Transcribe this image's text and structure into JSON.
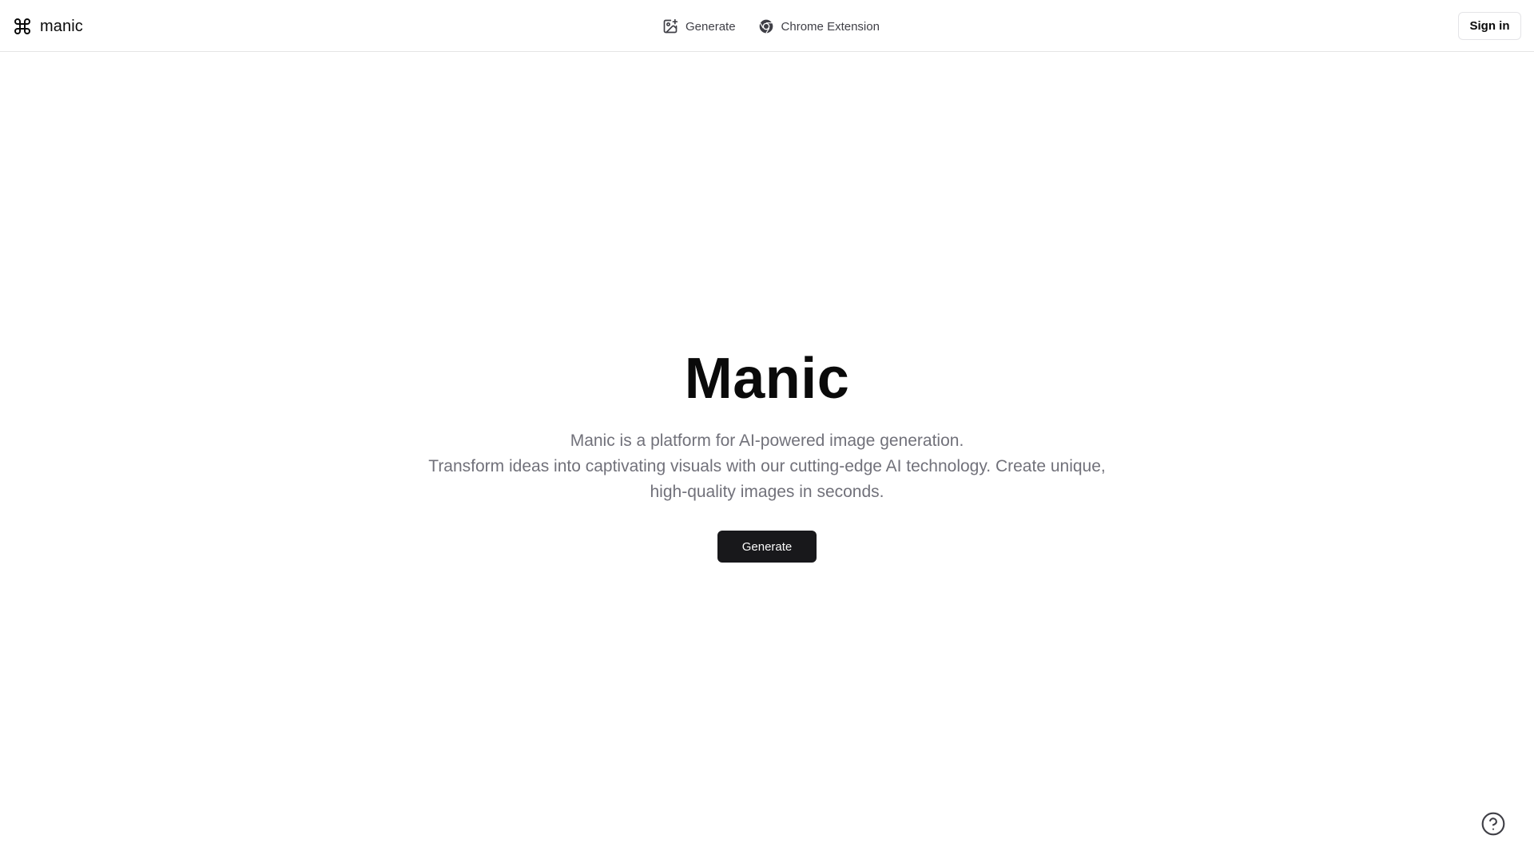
{
  "header": {
    "brand": {
      "icon": "command-icon",
      "label": "manic"
    },
    "nav": [
      {
        "icon": "image-plus-icon",
        "label": "Generate"
      },
      {
        "icon": "chrome-icon",
        "label": "Chrome Extension"
      }
    ],
    "signin_label": "Sign in"
  },
  "hero": {
    "title": "Manic",
    "tagline": "Manic is a platform for AI-powered image generation.",
    "description": "Transform ideas into captivating visuals with our cutting-edge AI technology. Create unique, high-quality images in seconds.",
    "cta_label": "Generate"
  },
  "help": {
    "icon": "help-circle-icon"
  },
  "colors": {
    "text": "#0a0a0a",
    "muted": "#71717a",
    "border": "#e5e5e5",
    "button_dark": "#18181b",
    "button_text": "#fafafa"
  }
}
